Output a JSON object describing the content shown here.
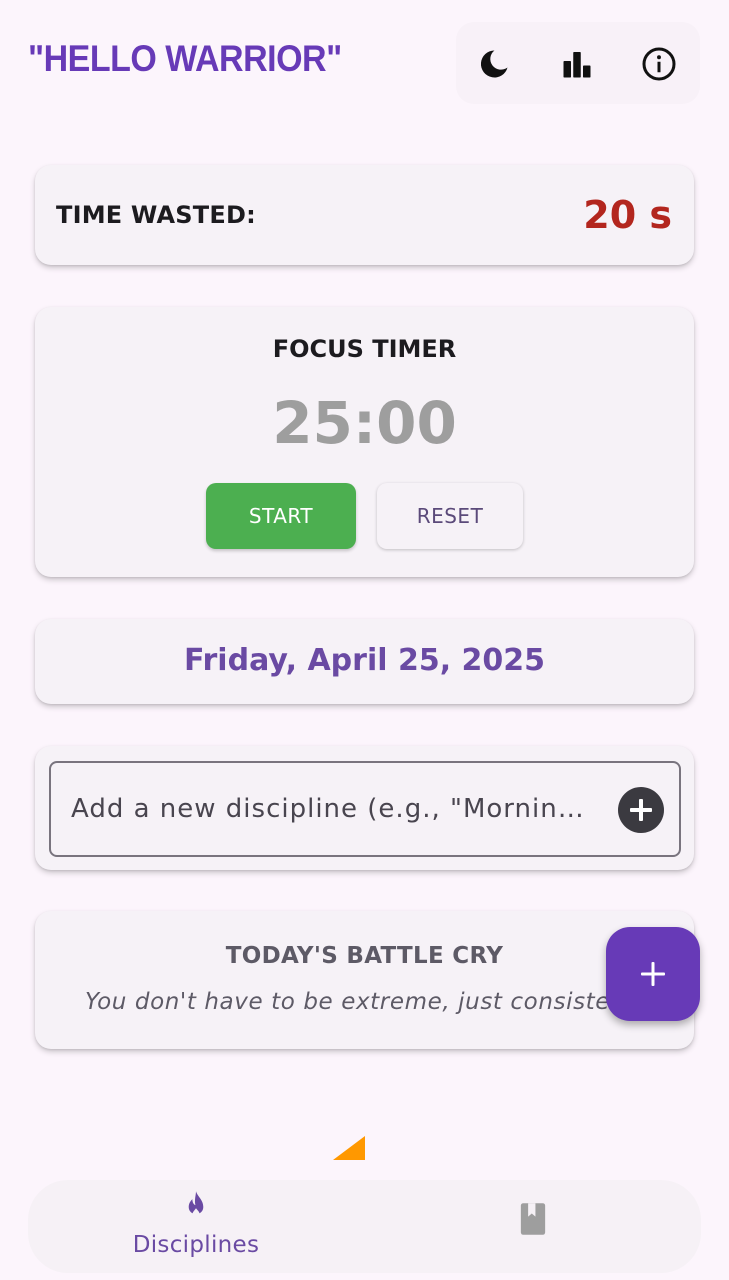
{
  "header": {
    "title": "\"HELLO WARRIOR\"",
    "actions": [
      {
        "icon": "moon-icon"
      },
      {
        "icon": "bar-chart-icon"
      },
      {
        "icon": "info-icon"
      }
    ]
  },
  "time_wasted": {
    "label": "TIME WASTED:",
    "value": "20 s"
  },
  "focus_timer": {
    "title": "FOCUS TIMER",
    "time": "25:00",
    "start_label": "START",
    "reset_label": "RESET"
  },
  "date": {
    "text": "Friday, April 25, 2025"
  },
  "add_discipline": {
    "placeholder": "Add a new discipline (e.g., \"Mornin…",
    "value": ""
  },
  "battle_cry": {
    "title": "TODAY'S BATTLE CRY",
    "quote": "You don't have to be extreme, just consistent."
  },
  "fab": {
    "icon": "plus-icon"
  },
  "bottom_nav": {
    "items": [
      {
        "label": "Disciplines",
        "icon": "fire-icon",
        "selected": true
      },
      {
        "label": "",
        "icon": "book-icon",
        "selected": false
      }
    ]
  },
  "colors": {
    "accent": "#673ab7",
    "start_button": "#4caf50",
    "time_wasted_value": "#b3261e",
    "date_text": "#6a4aa3",
    "background": "#fcf5fc"
  }
}
